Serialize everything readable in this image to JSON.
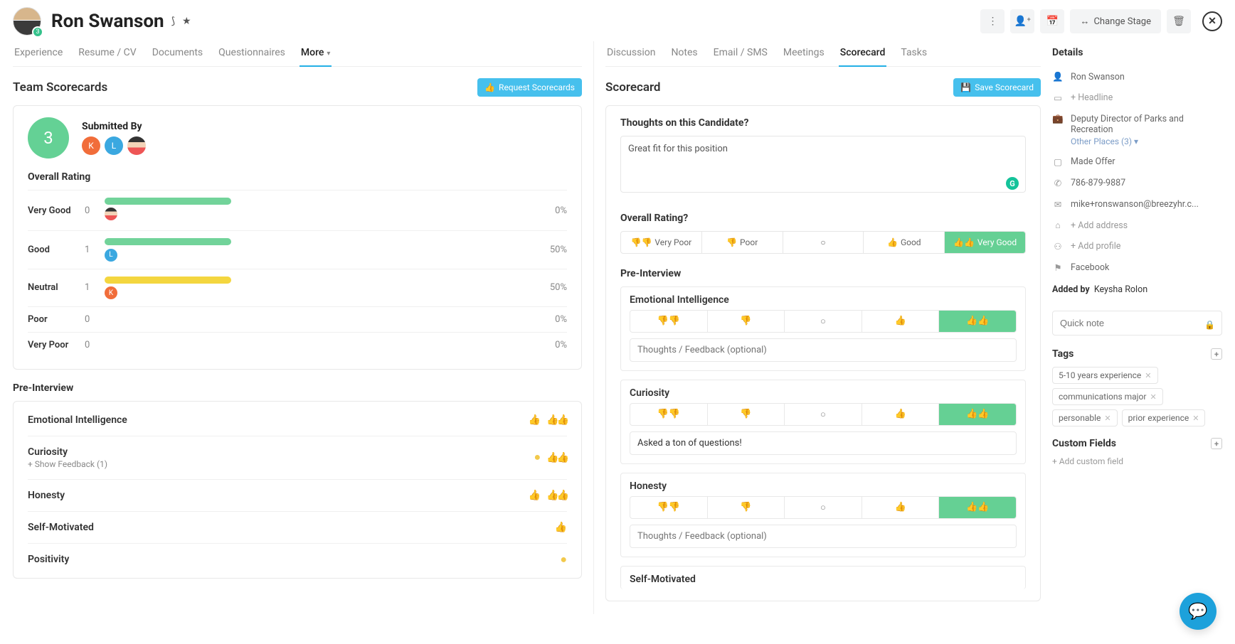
{
  "candidate": {
    "name": "Ron Swanson",
    "badge": "3"
  },
  "header_actions": {
    "change_stage": "Change Stage"
  },
  "tabs_left": {
    "experience": "Experience",
    "resume": "Resume / CV",
    "documents": "Documents",
    "questionnaires": "Questionnaires",
    "more": "More"
  },
  "tabs_mid": {
    "discussion": "Discussion",
    "notes": "Notes",
    "email": "Email / SMS",
    "meetings": "Meetings",
    "scorecard": "Scorecard",
    "tasks": "Tasks"
  },
  "team_scorecards": {
    "title": "Team Scorecards",
    "request_btn": "Request Scorecards",
    "submitted_by": "Submitted By",
    "count": "3",
    "overall_rating_label": "Overall Rating",
    "rows": {
      "very_good": {
        "label": "Very Good",
        "count": "0",
        "pct": "0%",
        "barw": "30%"
      },
      "good": {
        "label": "Good",
        "count": "1",
        "pct": "50%",
        "barw": "30%"
      },
      "neutral": {
        "label": "Neutral",
        "count": "1",
        "pct": "50%",
        "barw": "30%"
      },
      "poor": {
        "label": "Poor",
        "count": "0",
        "pct": "0%",
        "barw": "0"
      },
      "very_poor": {
        "label": "Very Poor",
        "count": "0",
        "pct": "0%",
        "barw": "0"
      }
    },
    "pre_interview_label": "Pre-Interview",
    "criteria": {
      "ei": {
        "name": "Emotional Intelligence"
      },
      "curiosity": {
        "name": "Curiosity",
        "fb": "+ Show Feedback (1)"
      },
      "honesty": {
        "name": "Honesty"
      },
      "self": {
        "name": "Self-Motivated"
      },
      "positivity": {
        "name": "Positivity"
      }
    }
  },
  "scorecard": {
    "title": "Scorecard",
    "save_btn": "Save Scorecard",
    "thoughts_label": "Thoughts on this Candidate?",
    "thoughts_value": "Great fit for this position",
    "overall_label": "Overall Rating?",
    "ratings": {
      "very_poor": "Very Poor",
      "poor": "Poor",
      "neutral": "",
      "good": "Good",
      "very_good": "Very Good"
    },
    "pre_interview_label": "Pre-Interview",
    "criteria": {
      "ei": {
        "name": "Emotional Intelligence",
        "fb_ph": "Thoughts / Feedback (optional)"
      },
      "cur": {
        "name": "Curiosity",
        "fb_val": "Asked a ton of questions!"
      },
      "hon": {
        "name": "Honesty",
        "fb_ph": "Thoughts / Feedback (optional)"
      },
      "self": {
        "name": "Self-Motivated"
      }
    }
  },
  "details": {
    "title": "Details",
    "name": "Ron Swanson",
    "headline_ph": "+ Headline",
    "position": "Deputy Director of Parks and Recreation",
    "other_places": "Other Places (3)",
    "stage": "Made Offer",
    "phone": "786-879-9887",
    "email": "mike+ronswanson@breezyhr.c...",
    "address_ph": "+ Add address",
    "profile_ph": "+ Add profile",
    "social": "Facebook",
    "added_by_label": "Added by",
    "added_by_value": "Keysha Rolon",
    "quicknote_ph": "Quick note",
    "tags_title": "Tags",
    "tags": {
      "t0": "5-10 years experience",
      "t1": "communications major",
      "t2": "personable",
      "t3": "prior experience"
    },
    "custom_fields_title": "Custom Fields",
    "add_cf": "+ Add custom field"
  }
}
